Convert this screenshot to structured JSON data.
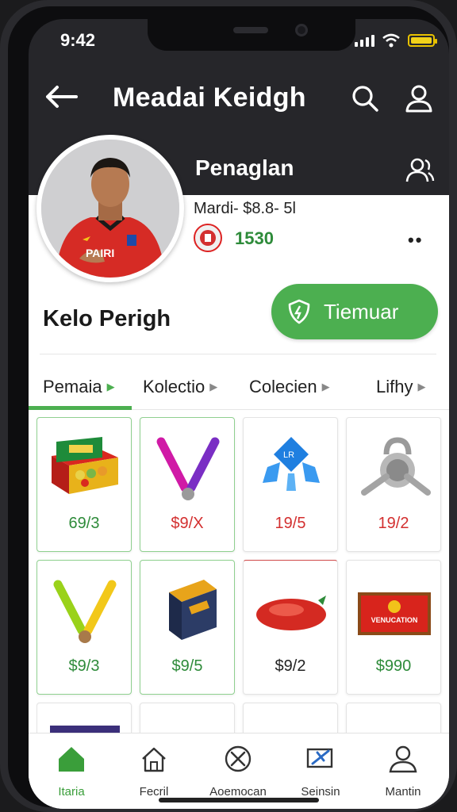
{
  "status_bar": {
    "time": "9:42"
  },
  "header": {
    "title": "Meadai Keidgh"
  },
  "profile": {
    "name": "Penaglan",
    "meta": "Mardi- $8.8- 5l",
    "coins": "1530",
    "username": "Kelo Perigh",
    "follow_label": "Tiemuar",
    "more": "••"
  },
  "tabs": [
    {
      "label": "Pemaia"
    },
    {
      "label": "Kolectio"
    },
    {
      "label": "Colecien"
    },
    {
      "label": "Lifhy"
    }
  ],
  "products": [
    {
      "price": "69/3",
      "price_color": "#2e8b3a",
      "art": "gift-box"
    },
    {
      "price": "$9/X",
      "price_color": "#d32f2f",
      "art": "pink-purple-sticks"
    },
    {
      "price": "19/5",
      "price_color": "#d32f2f",
      "art": "blue-gems"
    },
    {
      "price": "19/2",
      "price_color": "#d32f2f",
      "art": "silver-lock"
    },
    {
      "price": "$9/3",
      "price_color": "#2e8b3a",
      "art": "green-yellow-sticks"
    },
    {
      "price": "$9/5",
      "price_color": "#2e8b3a",
      "art": "navy-box"
    },
    {
      "price": "$9/2",
      "price_color": "#222222",
      "art": "red-stone"
    },
    {
      "price": "$990",
      "price_color": "#2e8b3a",
      "art": "red-banner"
    },
    {
      "price": "",
      "price_color": "#222222",
      "art": "partial"
    },
    {
      "price": "",
      "price_color": "#222222",
      "art": "partial"
    },
    {
      "price": "",
      "price_color": "#222222",
      "art": "partial"
    },
    {
      "price": "",
      "price_color": "#222222",
      "art": "partial"
    }
  ],
  "banner_text": "VENUCATION",
  "bottom_nav": [
    {
      "label": "Itaria"
    },
    {
      "label": "Fecril"
    },
    {
      "label": "Aoemocan"
    },
    {
      "label": "Seinsin"
    },
    {
      "label": "Mantin"
    }
  ],
  "colors": {
    "accent": "#4caf50",
    "dark": "#26262a"
  }
}
